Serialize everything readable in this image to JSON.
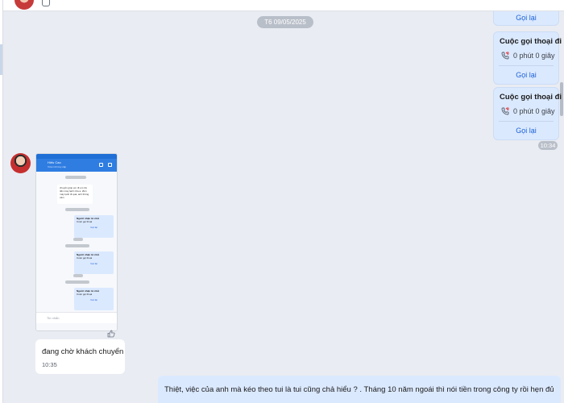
{
  "date_separator": "T6 09/05/2025",
  "call_cards": {
    "partial_top_action": "Gọi lại",
    "cards": [
      {
        "title": "Cuộc gọi thoại đi",
        "duration": "0 phút 0 giây",
        "action": "Gọi lại"
      },
      {
        "title": "Cuộc gọi thoại đi",
        "duration": "0 phút 0 giây",
        "action": "Gọi lại"
      }
    ],
    "time": "10:34"
  },
  "image_message": {
    "header_name": "Hiếu Cao",
    "header_sub": "Vừa mới truy cập",
    "white_bubble_text": "chuyển giùp em đi em trả tiền máy lạnh nha a. 2lên máy lạnh đi quá, anh thông cảm",
    "mini_cards": [
      {
        "title": "Người nhận từ chối",
        "sub": "Cuộc gọi thoại",
        "action": "Gọi lại"
      },
      {
        "title": "Người nhận từ chối",
        "sub": "Cuộc gọi thoại",
        "action": "Gọi lại"
      },
      {
        "title": "Người nhận từ chối",
        "sub": "Cuộc gọi thoại",
        "action": "Gọi lại"
      }
    ],
    "input_placeholder": "Tin nhắn"
  },
  "incoming_text": {
    "text": "đang chờ khách chuyển",
    "time": "10:35"
  },
  "outgoing_text": {
    "text": "Thiệt, việc của anh mà kéo theo tui là tui cũng chả hiểu ? . Tháng 10 năm ngoái thì nói tiền trong công ty rồi hẹn đủ kiểu,"
  },
  "colors": {
    "background": "#e9ecf2",
    "outgoing_bubble": "#dbe9ff",
    "link_blue": "#1c62d6",
    "missed_call_red": "#e0393e"
  },
  "icons": [
    "outgoing-call-icon",
    "like-icon",
    "chat-avatar",
    "header-avatar"
  ]
}
